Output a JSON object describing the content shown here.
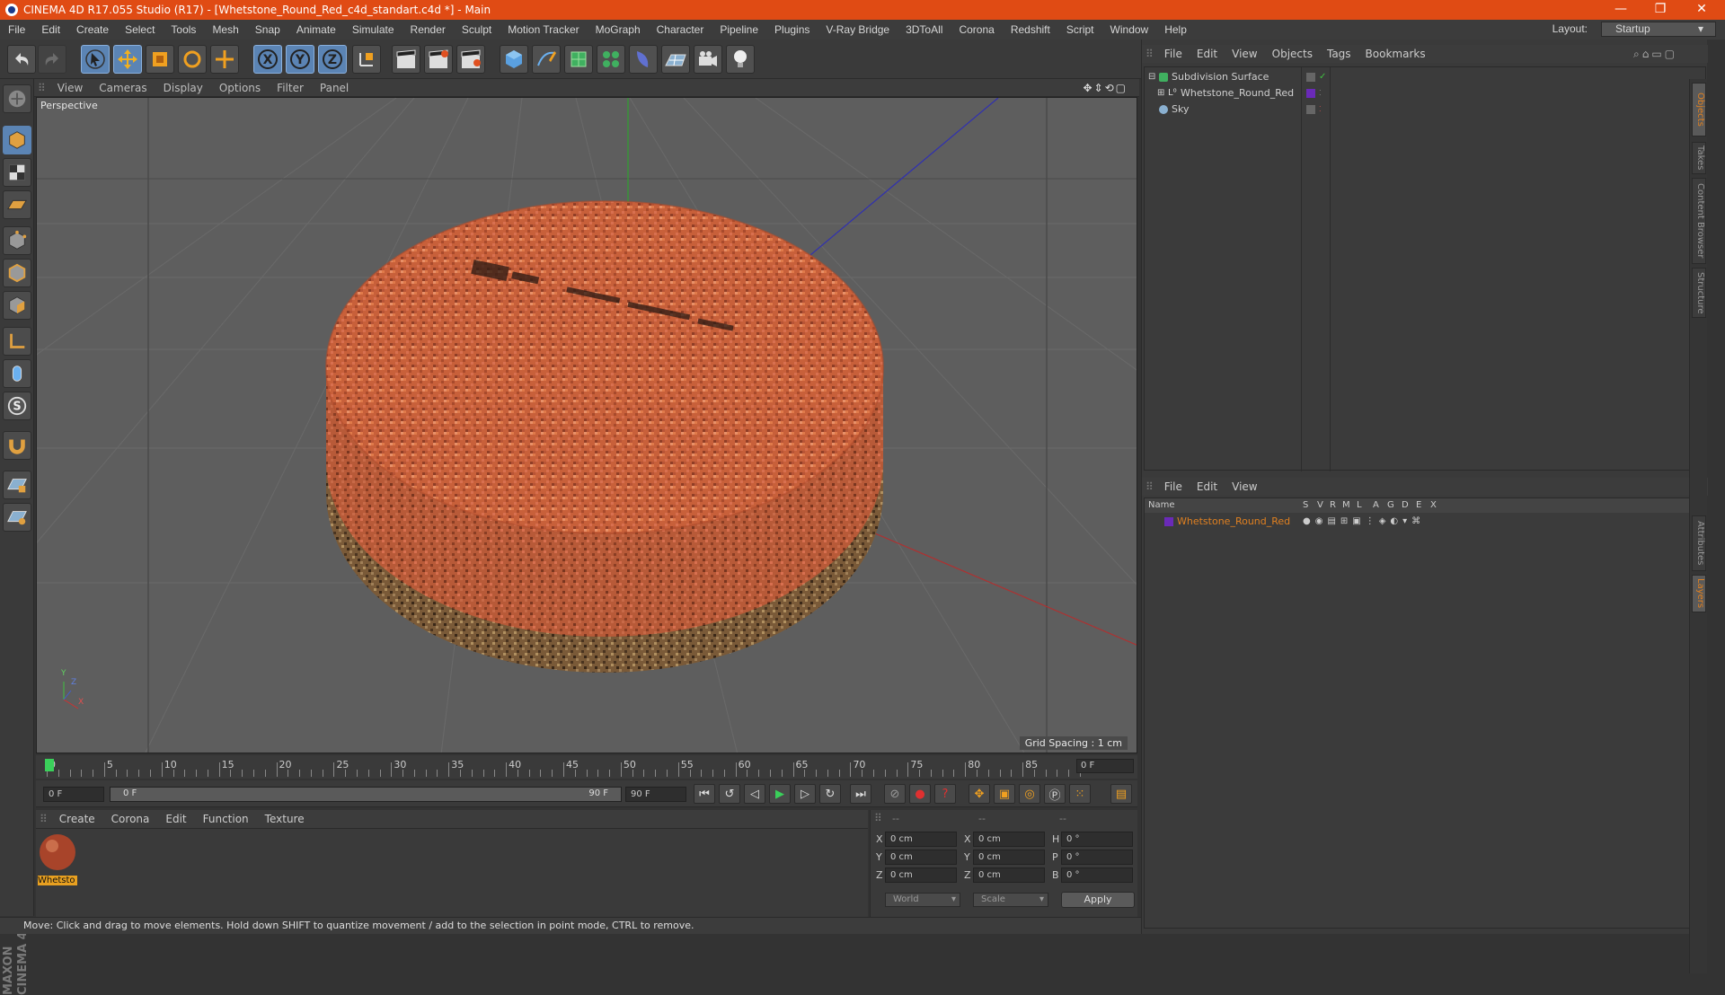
{
  "window": {
    "title": "CINEMA 4D R17.055 Studio (R17) - [Whetstone_Round_Red_c4d_standart.c4d *] - Main",
    "minimize": "—",
    "restore": "❐",
    "close": "✕"
  },
  "menu": [
    "File",
    "Edit",
    "Create",
    "Select",
    "Tools",
    "Mesh",
    "Snap",
    "Animate",
    "Simulate",
    "Render",
    "Sculpt",
    "Motion Tracker",
    "MoGraph",
    "Character",
    "Pipeline",
    "Plugins",
    "V-Ray Bridge",
    "3DToAll",
    "Corona",
    "Redshift",
    "Script",
    "Window",
    "Help"
  ],
  "layout": {
    "label": "Layout:",
    "value": "Startup"
  },
  "viewport": {
    "menu": [
      "View",
      "Cameras",
      "Display",
      "Options",
      "Filter",
      "Panel"
    ],
    "camera_label": "Perspective",
    "grid_spacing": "Grid Spacing : 1 cm",
    "axis_labels": {
      "y": "Y",
      "z": "Z",
      "x": "X"
    }
  },
  "timeline": {
    "ticks": [
      "0",
      "5",
      "10",
      "15",
      "20",
      "25",
      "30",
      "35",
      "40",
      "45",
      "50",
      "55",
      "60",
      "65",
      "70",
      "75",
      "80",
      "85",
      "90"
    ],
    "current_frame_box": "0 F"
  },
  "transport": {
    "start_field": "0 F",
    "range_left": "0 F",
    "range_right": "90 F",
    "end_field": "90 F"
  },
  "material_manager": {
    "menu": [
      "Create",
      "Corona",
      "Edit",
      "Function",
      "Texture"
    ],
    "material_name": "Whetsto"
  },
  "coordinates": {
    "headers": [
      "--",
      "--",
      "--"
    ],
    "rows": [
      {
        "a": "X",
        "av": "0 cm",
        "b": "X",
        "bv": "0 cm",
        "c": "H",
        "cv": "0 °"
      },
      {
        "a": "Y",
        "av": "0 cm",
        "b": "Y",
        "bv": "0 cm",
        "c": "P",
        "cv": "0 °"
      },
      {
        "a": "Z",
        "av": "0 cm",
        "b": "Z",
        "bv": "0 cm",
        "c": "B",
        "cv": "0 °"
      }
    ],
    "mode": "World",
    "size_mode": "Scale",
    "apply": "Apply"
  },
  "status": "Move: Click and drag to move elements. Hold down SHIFT to quantize movement / add to the selection in point mode, CTRL to remove.",
  "object_manager": {
    "menu": [
      "File",
      "Edit",
      "View",
      "Objects",
      "Tags",
      "Bookmarks"
    ],
    "objects": [
      {
        "name": "Subdivision Surface"
      },
      {
        "name": "Whetstone_Round_Red"
      },
      {
        "name": "Sky"
      }
    ]
  },
  "layer_manager": {
    "menu": [
      "File",
      "Edit",
      "View"
    ],
    "columns": [
      "Name",
      "S",
      "V",
      "R",
      "M",
      "L",
      "A",
      "G",
      "D",
      "E",
      "X"
    ],
    "layer_name": "Whetstone_Round_Red"
  },
  "side_tabs": [
    "Objects",
    "Takes",
    "Content Browser",
    "Structure",
    "Attributes",
    "Layers"
  ],
  "brand": "MAXON CINEMA 4D",
  "colors": {
    "title_bar": "#e04b14",
    "active_blue": "#5b84b4",
    "layer_orange": "#e08020",
    "layer_purple": "#6a2ab8",
    "stone_top": "#c8603a",
    "stone_base": "#7a5a38"
  }
}
